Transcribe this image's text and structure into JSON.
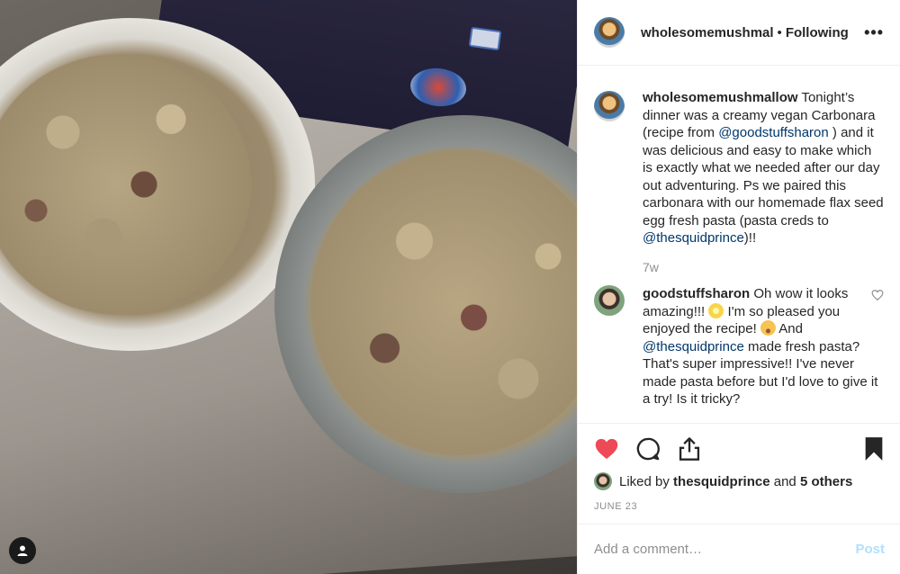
{
  "header": {
    "username": "wholesomemushmal",
    "separator": "•",
    "follow_status": "Following",
    "more_label": "•••"
  },
  "caption": {
    "username": "wholesomemushmallow",
    "text_1": "Tonight’s dinner was a creamy vegan Carbonara (recipe from ",
    "mention_1": "@goodstuffsharon",
    "text_2": " ) and it was delicious and easy to make which is exactly what we needed after our day out adventuring. Ps we paired this carbonara with our homemade flax seed egg fresh pasta (pasta creds to ",
    "mention_2": "@thesquidprince",
    "text_3": ")!!",
    "time": "7w"
  },
  "comment": {
    "username": "goodstuffsharon",
    "text_1": "Oh wow it looks amazing!!! ",
    "text_2": " I'm so pleased you enjoyed the recipe! ",
    "text_3": " And ",
    "mention": "@thesquidprince",
    "text_4": " made fresh pasta? That's super impressive!! I've never made pasta before but I'd love to give it a try! Is it tricky?"
  },
  "actions": {
    "liked_prefix": "Liked by",
    "liked_user": "thesquidprince",
    "liked_and": "and",
    "liked_others": "5 others",
    "date": "JUNE 23",
    "heart_color": "#ed4956"
  },
  "add_comment": {
    "placeholder": "Add a comment…",
    "post_label": "Post"
  },
  "icons": [
    "heart-icon",
    "comment-icon",
    "share-icon",
    "bookmark-icon",
    "user-icon",
    "more-icon",
    "like-comment-icon"
  ]
}
